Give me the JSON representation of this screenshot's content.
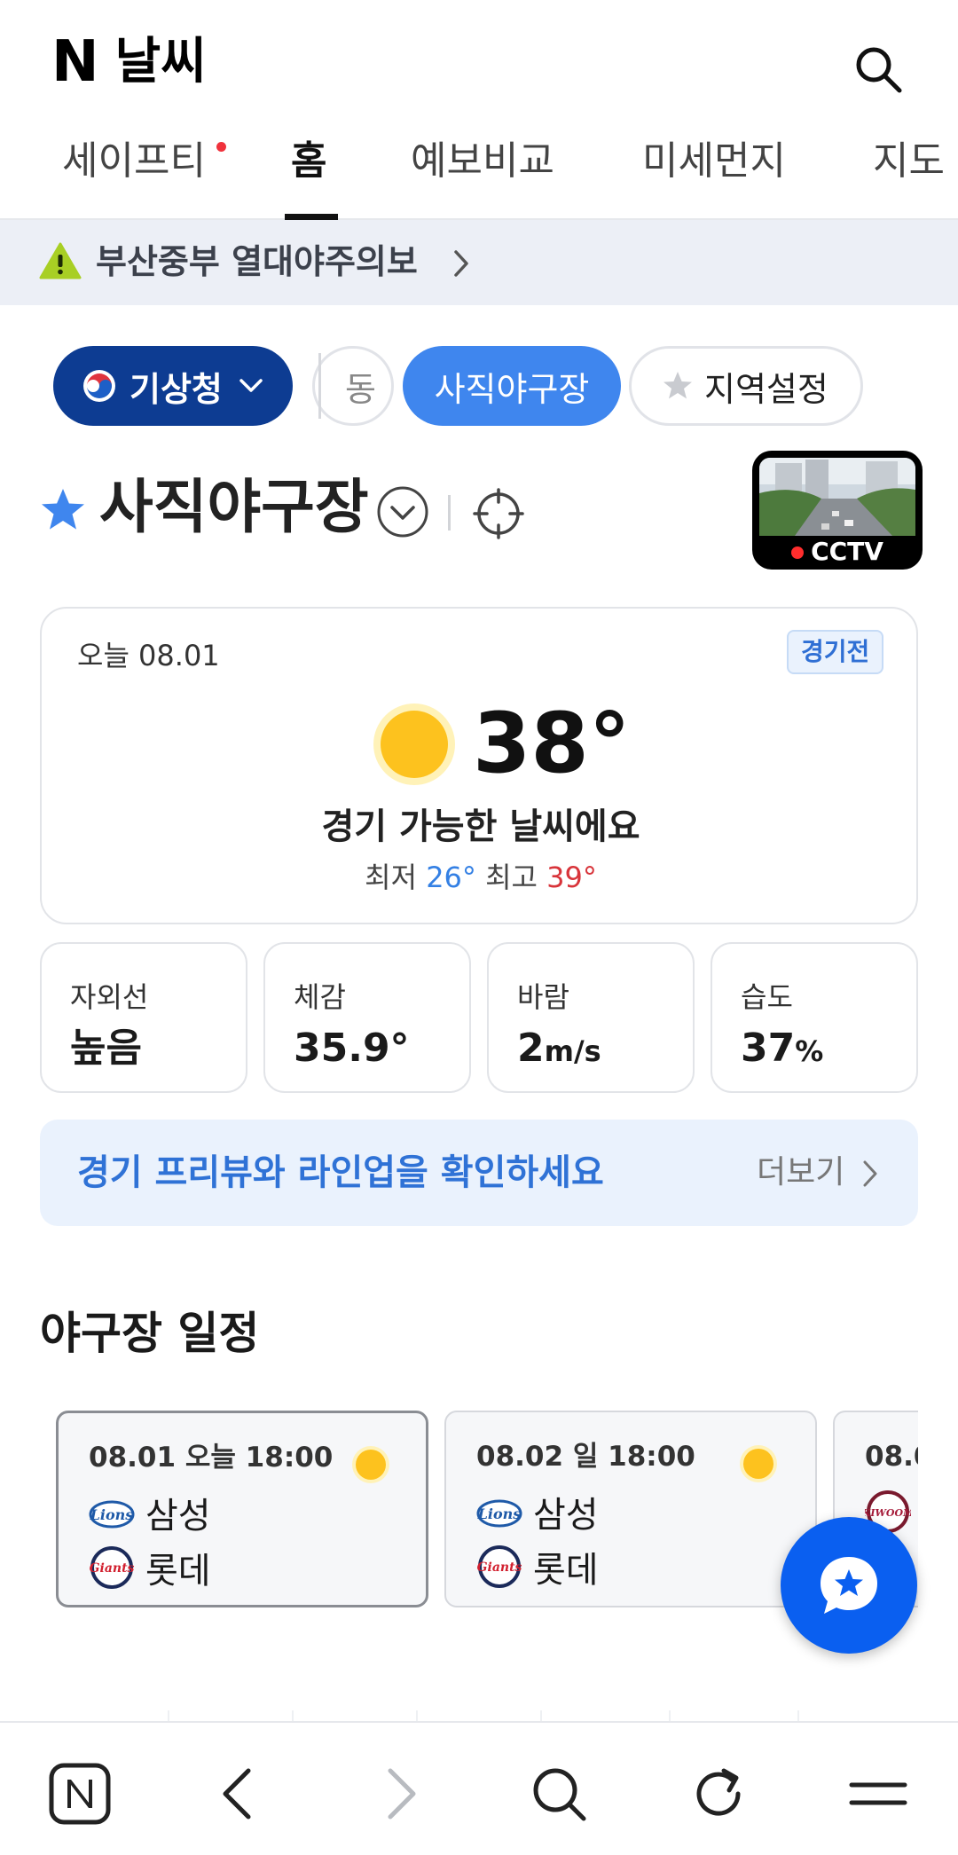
{
  "header": {
    "logo": "N",
    "title": "날씨"
  },
  "tabs": [
    {
      "label": "세이프티",
      "has_new_dot": true
    },
    {
      "label": "홈",
      "active": true
    },
    {
      "label": "예보비교"
    },
    {
      "label": "미세먼지"
    },
    {
      "label": "지도"
    }
  ],
  "warning": {
    "label": "부산중부 열대야주의보"
  },
  "chips": {
    "source": "기상청",
    "partial": "동",
    "selected_location": "사직야구장",
    "region_setting": "지역설정"
  },
  "location": {
    "name": "사직야구장",
    "cctv_label": "CCTV"
  },
  "today": {
    "date": "오늘 08.01",
    "status": "경기전",
    "temperature": "38°",
    "description": "경기 가능한 날씨에요",
    "min_label": "최저",
    "min_value": "26°",
    "max_label": "최고",
    "max_value": "39°"
  },
  "stats": [
    {
      "label": "자외선",
      "value": "높음",
      "unit": ""
    },
    {
      "label": "체감",
      "value": "35.9°",
      "unit": ""
    },
    {
      "label": "바람",
      "value": "2",
      "unit": "m/s"
    },
    {
      "label": "습도",
      "value": "37",
      "unit": "%"
    }
  ],
  "preview": {
    "text": "경기 프리뷰와 라인업을 확인하세요",
    "more": "더보기"
  },
  "schedule": {
    "title": "야구장 일정",
    "games": [
      {
        "time": "08.01 오늘 18:00",
        "away": "삼성",
        "home": "롯데",
        "away_logo": "lions-logo",
        "home_logo": "giants-logo"
      },
      {
        "time": "08.02 일 18:00",
        "away": "삼성",
        "home": "롯데",
        "away_logo": "lions-logo",
        "home_logo": "giants-logo"
      },
      {
        "time": "08.0",
        "away": "",
        "home": "",
        "away_logo": "kiwoom-logo",
        "home_logo": ""
      }
    ]
  },
  "colors": {
    "accent_blue": "#3f86ee",
    "kma_navy": "#0d3c92",
    "min_temp": "#3480e4",
    "max_temp": "#d8343a",
    "fab": "#0a5ff0"
  }
}
